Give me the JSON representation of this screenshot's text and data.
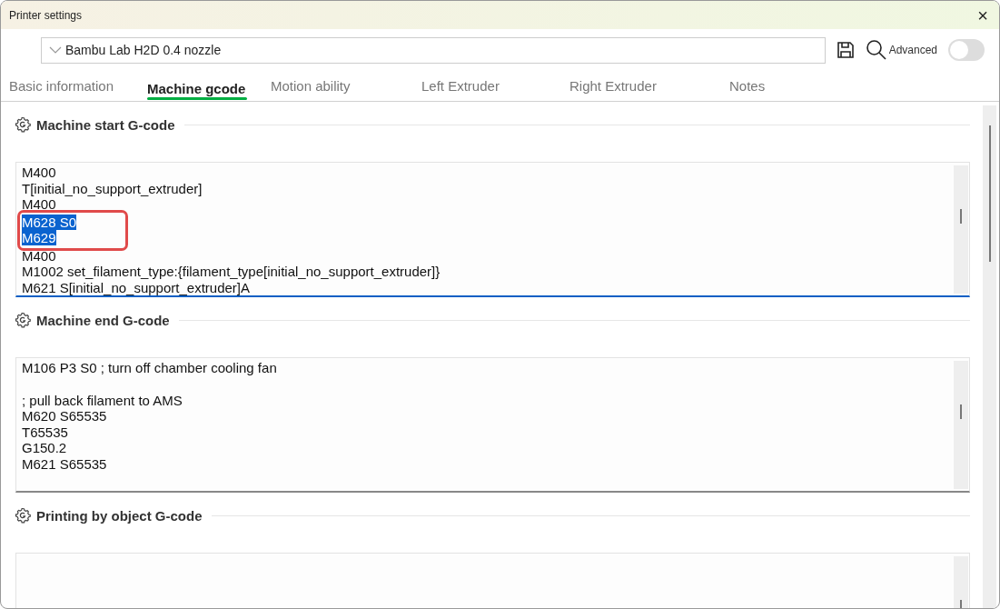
{
  "window": {
    "title": "Printer settings",
    "close": "×"
  },
  "preset": {
    "value": "Bambu Lab H2D 0.4 nozzle"
  },
  "advanced": {
    "label": "Advanced",
    "on": false
  },
  "tabs": [
    {
      "label": "Basic information",
      "selected": false
    },
    {
      "label": "Machine gcode",
      "selected": true
    },
    {
      "label": "Motion ability",
      "selected": false
    },
    {
      "label": "Left Extruder",
      "selected": false
    },
    {
      "label": "Right Extruder",
      "selected": false
    },
    {
      "label": "Notes",
      "selected": false
    }
  ],
  "sections": [
    {
      "title": "Machine start G-code",
      "focused": true,
      "annotated": true,
      "lines": [
        {
          "text": "M400",
          "selected": false
        },
        {
          "text": "T[initial_no_support_extruder]",
          "selected": false
        },
        {
          "text": "M400",
          "selected": false
        },
        {
          "text": "M628 S0",
          "selected": true
        },
        {
          "text": "M629",
          "selected": true
        },
        {
          "text": "M400",
          "selected": false
        },
        {
          "text": "M1002 set_filament_type:{filament_type[initial_no_support_extruder]}",
          "selected": false
        },
        {
          "text": "M621 S[initial_no_support_extruder]A",
          "selected": false
        }
      ]
    },
    {
      "title": "Machine end G-code",
      "focused": false,
      "lines": [
        {
          "text": "M106 P3 S0 ; turn off chamber cooling fan",
          "selected": false
        },
        {
          "text": "; pull back filament to AMS",
          "selected": false,
          "blank_line_before": true
        },
        {
          "text": "M620 S65535",
          "selected": false
        },
        {
          "text": "T65535",
          "selected": false
        },
        {
          "text": "G150.2",
          "selected": false
        },
        {
          "text": "M621 S65535",
          "selected": false
        }
      ]
    },
    {
      "title": "Printing by object G-code"
    }
  ]
}
